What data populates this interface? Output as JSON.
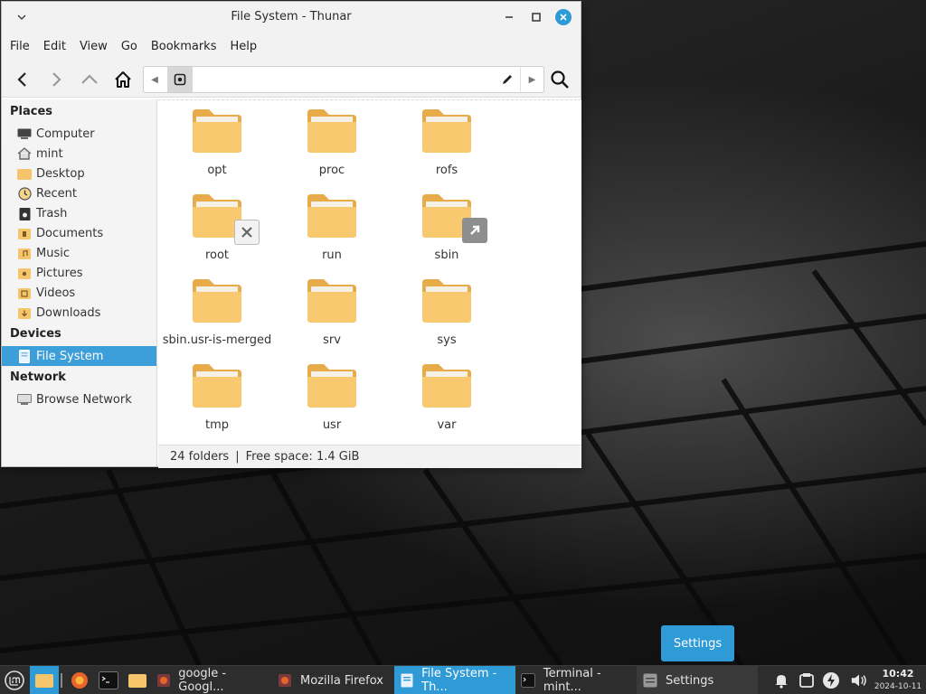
{
  "window": {
    "title": "File System - Thunar",
    "menu": [
      "File",
      "Edit",
      "View",
      "Go",
      "Bookmarks",
      "Help"
    ]
  },
  "sidebar": {
    "places_header": "Places",
    "places": [
      {
        "label": "Computer",
        "icon": "computer-icon"
      },
      {
        "label": "mint",
        "icon": "home-icon"
      },
      {
        "label": "Desktop",
        "icon": "desktop-folder-icon"
      },
      {
        "label": "Recent",
        "icon": "recent-icon"
      },
      {
        "label": "Trash",
        "icon": "trash-icon"
      },
      {
        "label": "Documents",
        "icon": "documents-folder-icon"
      },
      {
        "label": "Music",
        "icon": "music-folder-icon"
      },
      {
        "label": "Pictures",
        "icon": "pictures-folder-icon"
      },
      {
        "label": "Videos",
        "icon": "videos-folder-icon"
      },
      {
        "label": "Downloads",
        "icon": "downloads-folder-icon"
      }
    ],
    "devices_header": "Devices",
    "devices": [
      {
        "label": "File System",
        "icon": "drive-icon",
        "selected": true
      }
    ],
    "network_header": "Network",
    "network": [
      {
        "label": "Browse Network",
        "icon": "network-icon"
      }
    ]
  },
  "content": {
    "items": [
      {
        "label": "opt"
      },
      {
        "label": "proc"
      },
      {
        "label": "rofs"
      },
      {
        "label": "root",
        "emblem": "locked-x-emblem-icon"
      },
      {
        "label": "run"
      },
      {
        "label": "sbin",
        "emblem": "symlink-arrow-emblem-icon"
      },
      {
        "label": "sbin.usr-is-merged"
      },
      {
        "label": "srv"
      },
      {
        "label": "sys"
      },
      {
        "label": "tmp"
      },
      {
        "label": "usr"
      },
      {
        "label": "var"
      }
    ]
  },
  "status": {
    "folders": "24 folders",
    "separator": "|",
    "free_space": "Free space: 1.4 GiB"
  },
  "desktop": {
    "settings_popup": "Settings"
  },
  "taskbar": {
    "tasks": [
      {
        "label": "google - Googl...",
        "icon": "firefox-icon"
      },
      {
        "label": "Mozilla Firefox",
        "icon": "firefox-icon"
      },
      {
        "label": "File System - Th...",
        "icon": "file-manager-icon",
        "active": true
      },
      {
        "label": "Terminal - mint...",
        "icon": "terminal-icon"
      },
      {
        "label": "Settings",
        "icon": "settings-icon"
      }
    ],
    "clock_time": "10:42",
    "clock_date": "2024-10-11"
  },
  "colors": {
    "accent": "#2e9ad6",
    "folder": "#f6c46b",
    "taskbar": "#2d2d2d"
  }
}
